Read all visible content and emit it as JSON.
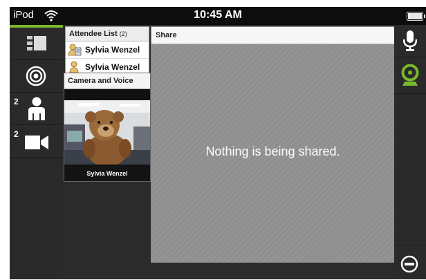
{
  "status_bar": {
    "carrier": "iPod",
    "time": "10:45 AM"
  },
  "left_rail": {
    "items": [
      {
        "name": "panels",
        "icon": "panels-icon"
      },
      {
        "name": "broadcast",
        "icon": "broadcast-icon"
      },
      {
        "name": "attendees",
        "icon": "person-icon",
        "count": "2"
      },
      {
        "name": "video",
        "icon": "video-camera-icon",
        "count": "2"
      }
    ],
    "active_color": "#7ab82d"
  },
  "right_rail": {
    "items": [
      {
        "name": "microphone",
        "icon": "microphone-icon"
      },
      {
        "name": "webcam",
        "icon": "webcam-icon",
        "color": "#7ab82d"
      },
      {
        "name": "leave",
        "icon": "minus-circle-icon"
      }
    ]
  },
  "attendee_list": {
    "title": "Attendee List",
    "count": "(2)",
    "attendees": [
      {
        "name": "Sylvia Wenzel"
      },
      {
        "name": "Sylvia Wenzel"
      }
    ]
  },
  "camera_panel": {
    "title": "Camera and Voice",
    "participant_name": "Sylvia Wenzel"
  },
  "share_panel": {
    "title": "Share",
    "message": "Nothing is being shared."
  }
}
